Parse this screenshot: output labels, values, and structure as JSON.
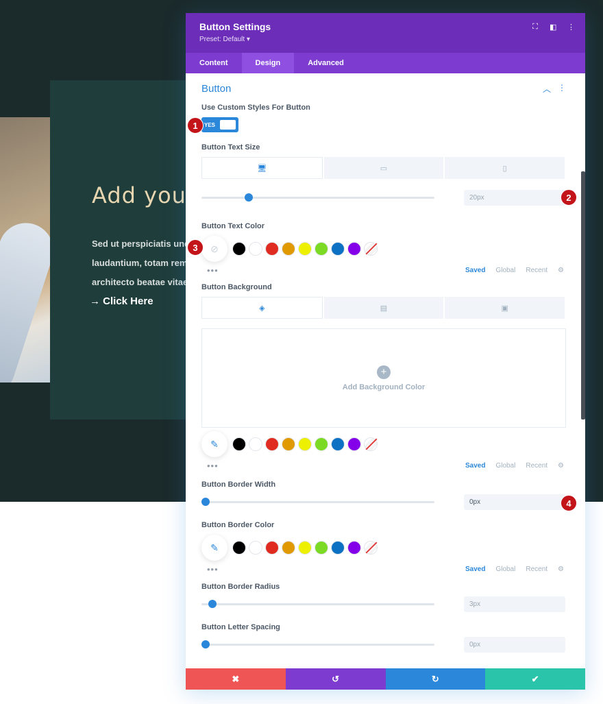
{
  "hero": {
    "title": "Add your",
    "text": [
      "Sed ut perspiciatis unde",
      "laudantium, totam rem",
      "architecto beatae vitae"
    ],
    "link": "→ Click Here"
  },
  "modal": {
    "title": "Button Settings",
    "preset": "Preset: Default ▾",
    "icons": [
      "focus-icon",
      "sidebar-icon",
      "more-icon"
    ],
    "tabs": [
      "Content",
      "Design",
      "Advanced"
    ],
    "active_tab": "Design",
    "section_title": "Button",
    "custom_styles_label": "Use Custom Styles For Button",
    "toggle_text": "YES",
    "text_size_label": "Button Text Size",
    "text_size_value": "20px",
    "text_size_level": 0.2,
    "text_color_label": "Button Text Color",
    "swatches": [
      "#000000",
      "#ffffff",
      "#e02b20",
      "#e09900",
      "#edf000",
      "#7cda24",
      "#0c71c3",
      "#8300e9"
    ],
    "palette_tabs": [
      "Saved",
      "Global",
      "Recent"
    ],
    "bg_label": "Button Background",
    "add_bg": "Add Background Color",
    "border_width_label": "Button Border Width",
    "border_width_value": "0px",
    "border_color_label": "Button Border Color",
    "border_radius_label": "Button Border Radius",
    "border_radius_value": "3px",
    "letter_spacing_label": "Button Letter Spacing",
    "letter_spacing_value": "0px"
  },
  "footer": {
    "cancel": "✖",
    "undo": "↺",
    "redo": "↻",
    "save": "✔"
  },
  "badges": [
    "1",
    "2",
    "3",
    "4"
  ]
}
